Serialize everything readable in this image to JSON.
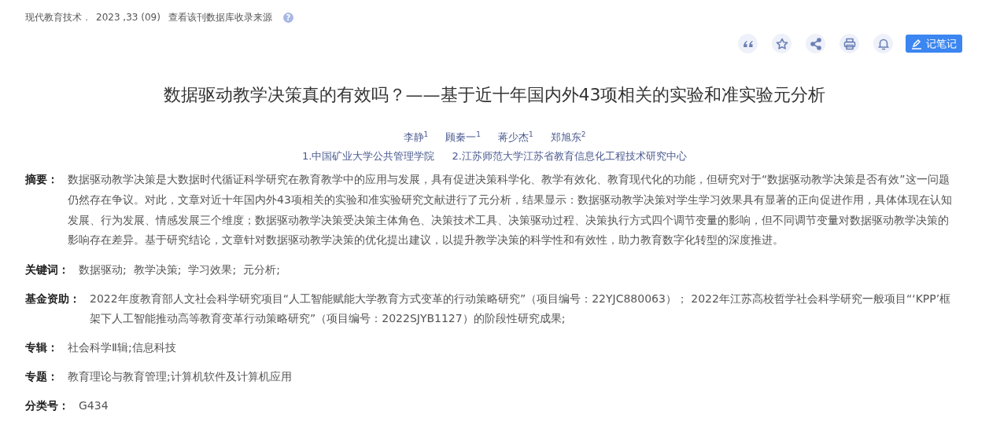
{
  "source": {
    "journal": "现代教育技术．",
    "issue": "2023 ,33 (09)",
    "db_link": "查看该刊数据库收录来源",
    "help": "?"
  },
  "toolbar": [
    {
      "kind": "quote"
    },
    {
      "kind": "star"
    },
    {
      "kind": "share"
    },
    {
      "kind": "print"
    },
    {
      "kind": "bell"
    }
  ],
  "note_button": "记笔记",
  "title": "数据驱动教学决策真的有效吗？——基于近十年国内外43项相关的实验和准实验元分析",
  "authors": [
    "李静$^{1}$",
    "顾秦一$^{1}$",
    "蒋少杰$^{1}$",
    "郑旭东$^{2}$"
  ],
  "affiliations": [
    "1.中国矿业大学公共管理学院",
    "2.江苏师范大学江苏省教育信息化工程技术研究中心"
  ],
  "fields": [
    {
      "kind": "text",
      "label": "摘要：",
      "value": "数据驱动教学决策是大数据时代循证科学研究在教育教学中的应用与发展，具有促进决策科学化、教学有效化、教育现代化的功能，但研究对于“数据驱动教学决策是否有效”这一问题仍然存在争议。对此，文章对近十年国内外43项相关的实验和准实验研究文献进行了元分析，结果显示：数据驱动教学决策对学生学习效果具有显著的正向促进作用，具体体现在认知发展、行为发展、情感发展三个维度；数据驱动教学决策受决策主体角色、决策技术工具、决策驱动过程、决策执行方式四个调节变量的影响，但不同调节变量对数据驱动教学决策的影响存在差异。基于研究结论，文章针对数据驱动教学决策的优化提出建议，以提升教学决策的科学性和有效性，助力教育数字化转型的深度推进。"
    },
    {
      "kind": "links",
      "label": "关键词：",
      "items": [
        "数据驱动;",
        "教学决策;",
        "学习效果;",
        "元分析;"
      ]
    },
    {
      "kind": "text",
      "label": "基金资助：",
      "value": "2022年度教育部人文社会科学研究项目“人工智能赋能大学教育方式变革的行动策略研究”（项目编号：22YJC880063）； 2022年江苏高校哲学社会科学研究一般项目“‘KPP’框架下人工智能推动高等教育变革行动策略研究”（项目编号：2022SJYB1127）的阶段性研究成果;"
    },
    {
      "kind": "text",
      "label": "专辑：",
      "value": "社会科学Ⅱ辑;信息科技"
    },
    {
      "kind": "text",
      "label": "专题：",
      "value": "教育理论与教育管理;计算机软件及计算机应用"
    },
    {
      "kind": "text",
      "label": "分类号：",
      "value": "G434"
    }
  ]
}
